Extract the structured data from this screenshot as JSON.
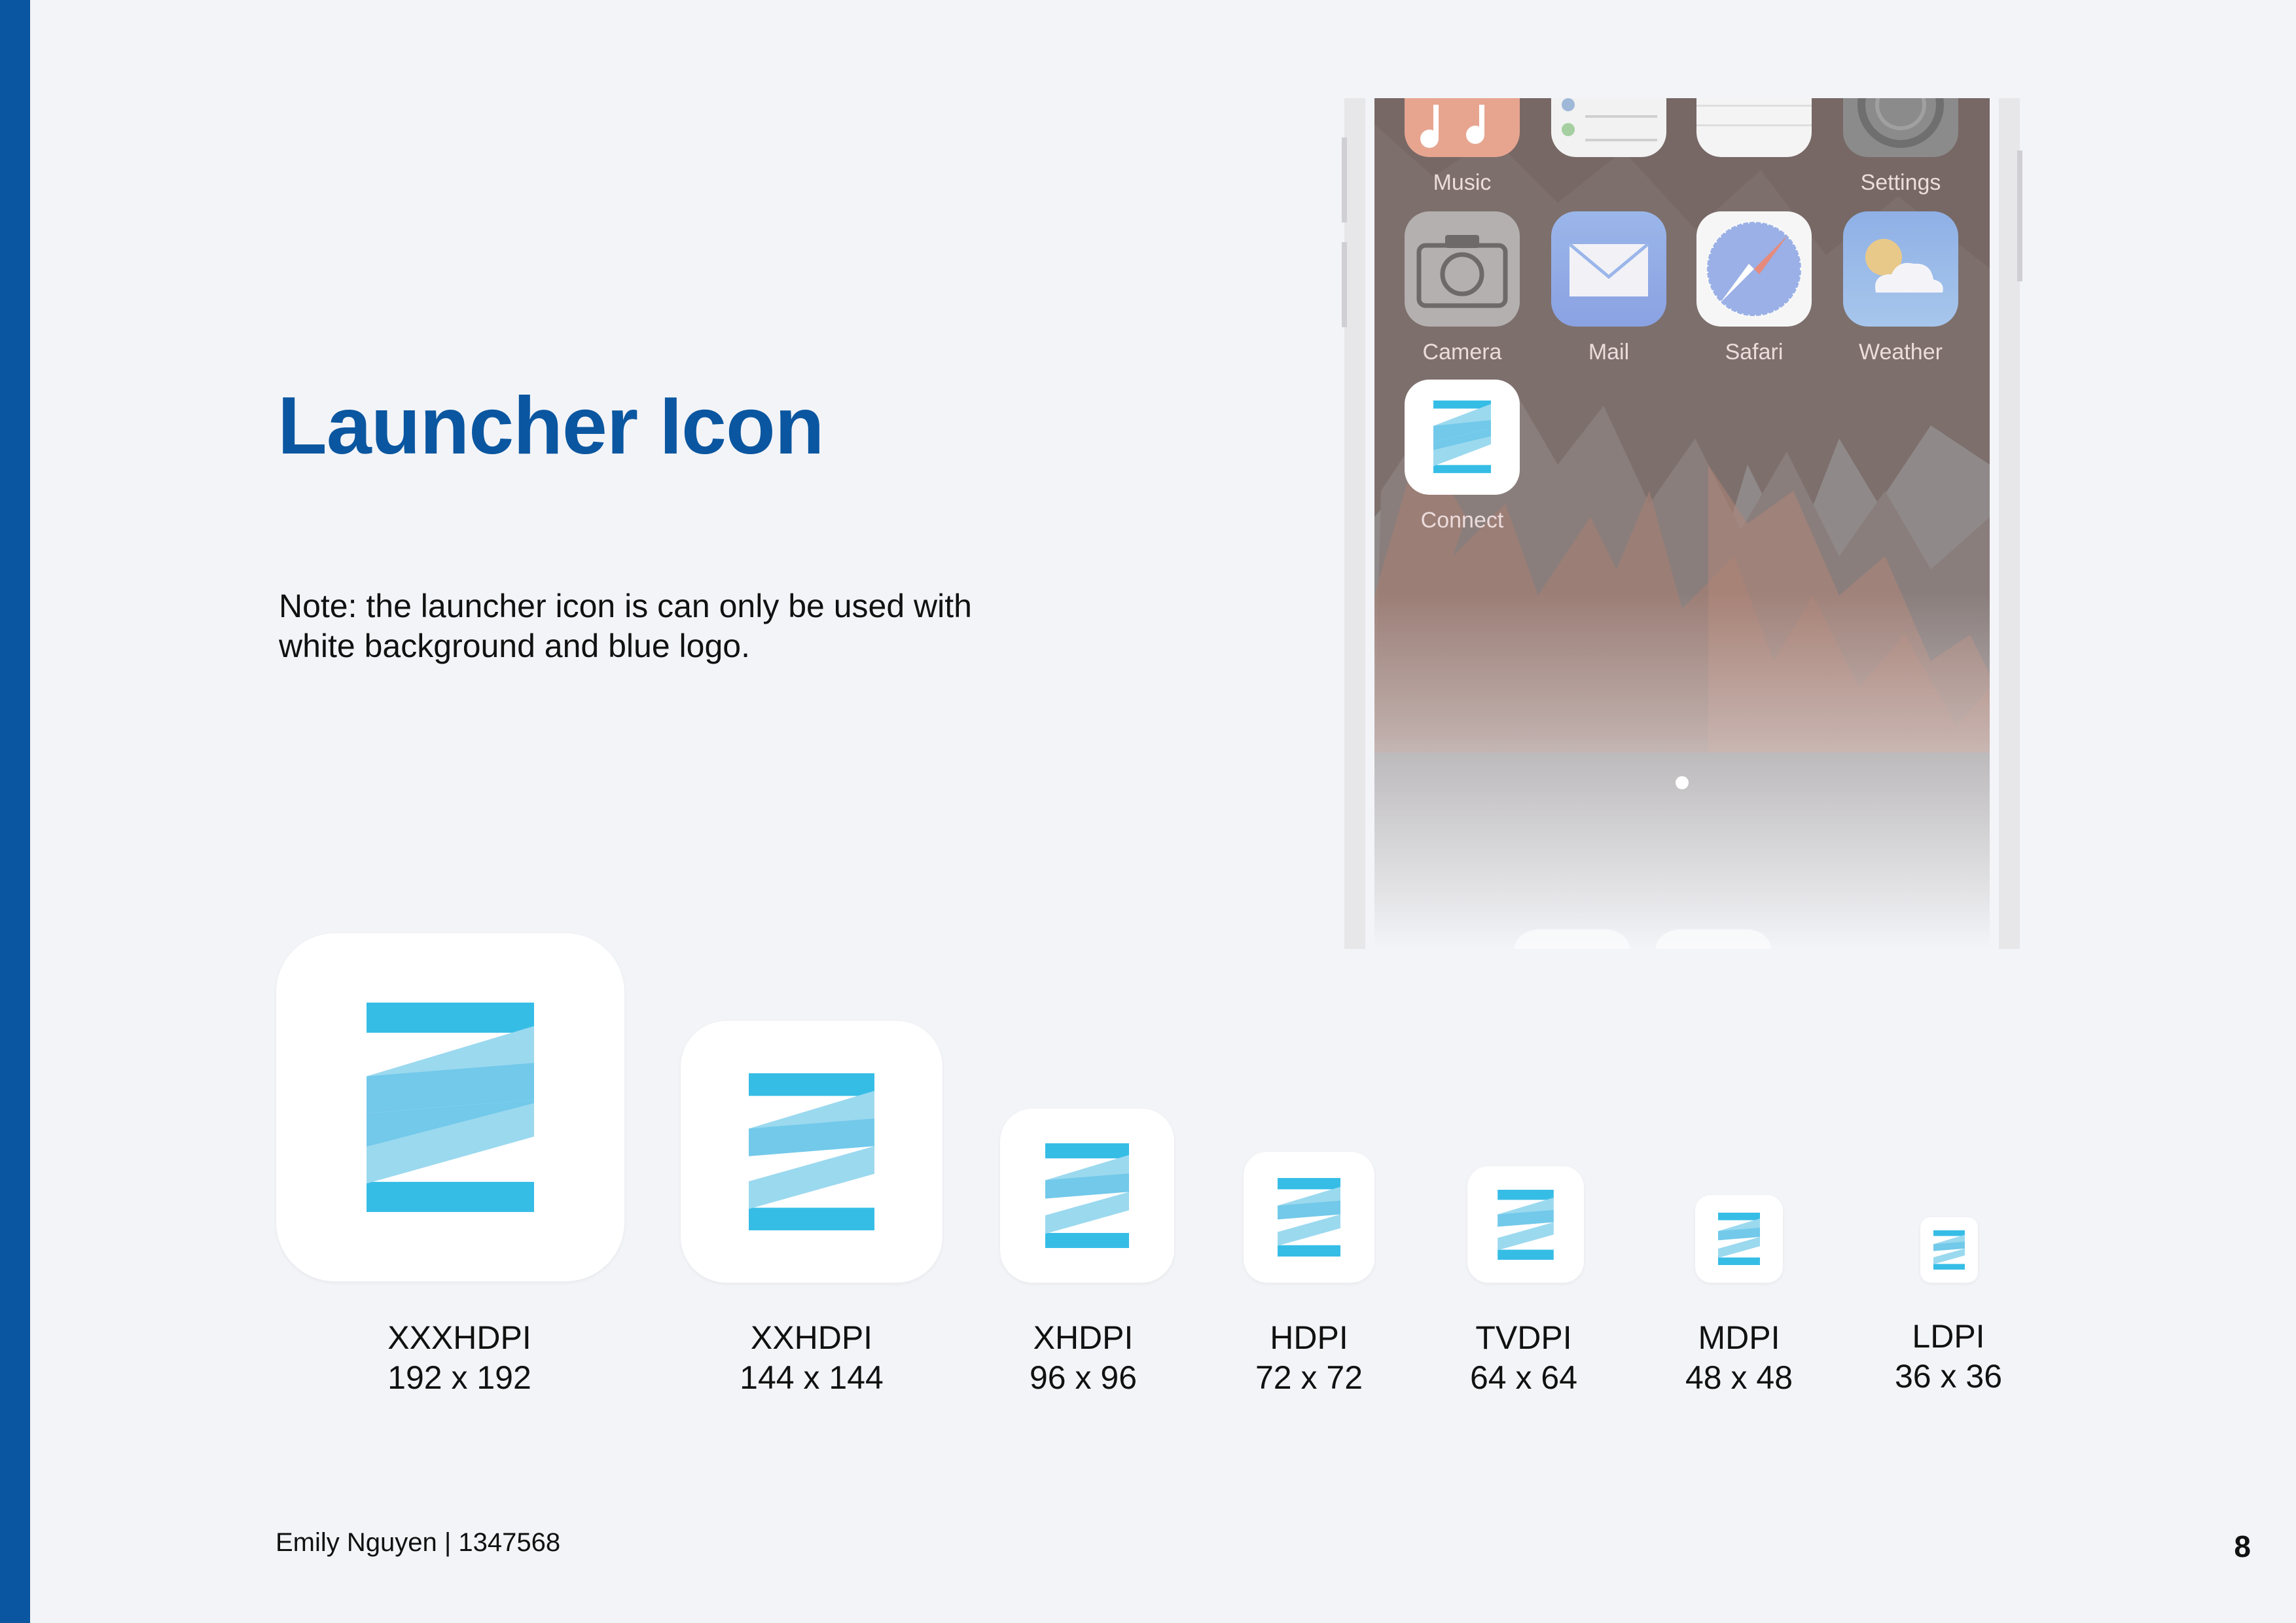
{
  "page": {
    "title": "Launcher Icon",
    "note": "Note: the launcher icon is can only be used with white background and blue logo.",
    "footer": "Emily Nguyen | 1347568",
    "page_number": "8"
  },
  "colors": {
    "accent": "#0a56a0",
    "logo_primary": "#36bde6",
    "logo_secondary": "#9bd9ef",
    "background": "#f3f4f8"
  },
  "phone": {
    "top_row": [
      "Music",
      "",
      "",
      "Settings"
    ],
    "apps": [
      {
        "label": "Camera",
        "icon": "camera-icon"
      },
      {
        "label": "Mail",
        "icon": "mail-icon"
      },
      {
        "label": "Safari",
        "icon": "safari-icon"
      },
      {
        "label": "Weather",
        "icon": "weather-icon"
      },
      {
        "label": "Connect",
        "icon": "connect-logo-icon"
      }
    ]
  },
  "icon_sizes": [
    {
      "density": "XXXHDPI",
      "size": "192 x 192"
    },
    {
      "density": "XXHDPI",
      "size": "144 x 144"
    },
    {
      "density": "XHDPI",
      "size": "96 x 96"
    },
    {
      "density": "HDPI",
      "size": "72 x 72"
    },
    {
      "density": "TVDPI",
      "size": "64 x 64"
    },
    {
      "density": "MDPI",
      "size": "48 x 48"
    },
    {
      "density": "LDPI",
      "size": "36 x 36"
    }
  ]
}
